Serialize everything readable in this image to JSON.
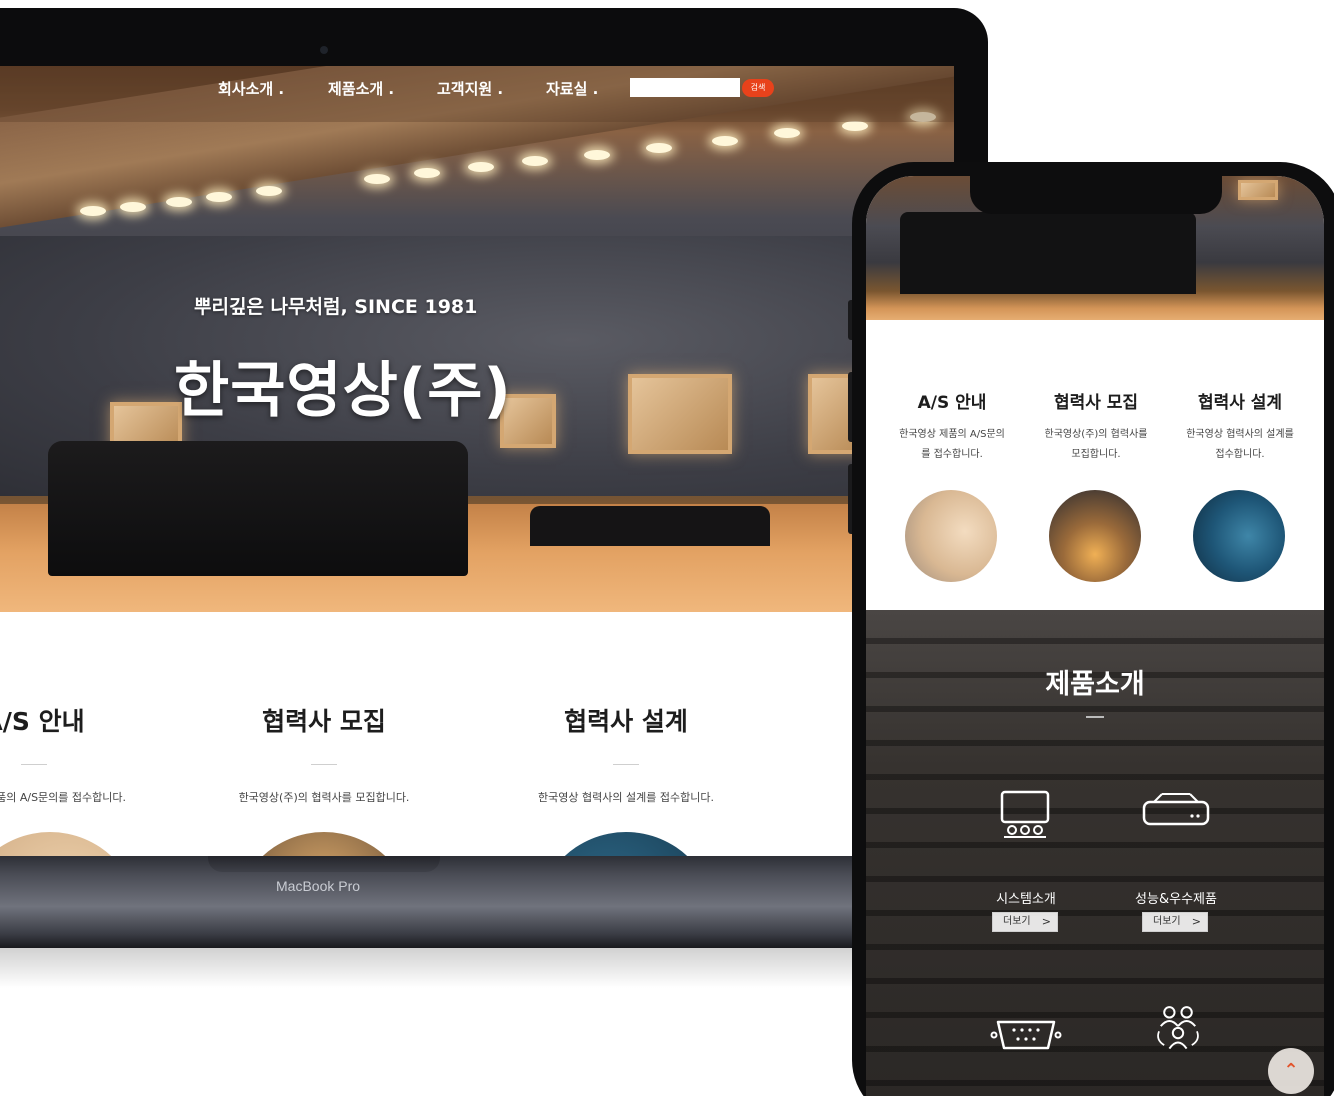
{
  "laptop": {
    "brand": "MacBook Pro",
    "nav": {
      "items": [
        "회사소개 .",
        "제품소개 .",
        "고객지원 .",
        "자료실 ."
      ],
      "search_placeholder": "",
      "search_button": "검색"
    },
    "hero": {
      "tagline": "뿌리깊은 나무처럼, SINCE 1981",
      "title": "한국영상(주)"
    },
    "services": [
      {
        "title": "A/S 안내",
        "text": "한국영상 제품의 A/S문의를 접수합니다."
      },
      {
        "title": "협력사 모집",
        "text": "한국영상(주)의 협력사를 모집합니다."
      },
      {
        "title": "협력사 설계",
        "text": "한국영상 협력사의 설계를 접수합니다."
      }
    ]
  },
  "phone": {
    "services": [
      {
        "title": "A/S 안내",
        "text_line1": "한국영상 제품의 A/S문의",
        "text_line2": "를 접수합니다."
      },
      {
        "title": "협력사 모집",
        "text_line1": "한국영상(주)의 협력사를",
        "text_line2": "모집합니다."
      },
      {
        "title": "협력사 설계",
        "text_line1": "한국영상 협력사의 설계를",
        "text_line2": "접수합니다."
      }
    ],
    "products": {
      "title": "제품소개",
      "items": [
        {
          "label": "시스템소개",
          "more": "더보기",
          "icon": "monitor-icon"
        },
        {
          "label": "성능&우수제품",
          "more": "더보기",
          "icon": "projector-icon"
        },
        {
          "label": "",
          "more": "",
          "icon": "connector-icon"
        },
        {
          "label": "",
          "more": "",
          "icon": "people-icon"
        }
      ]
    },
    "scroll_top_icon": "chevron-up-icon"
  },
  "colors": {
    "accent": "#e8421b",
    "dark": "#0d0d0e"
  }
}
